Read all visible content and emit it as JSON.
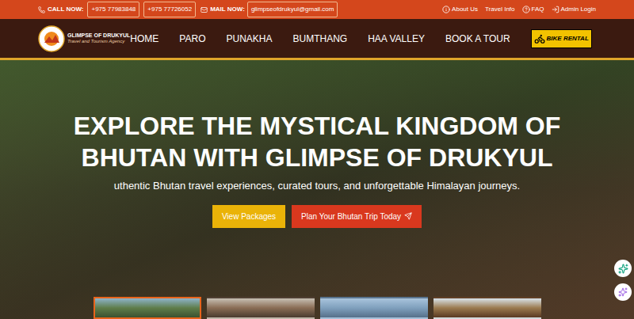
{
  "topbar": {
    "call_label": "CALL NOW:",
    "phones": [
      "+975 77983848",
      "+975 77726052"
    ],
    "mail_label": "MAIL NOW:",
    "email": "glimpseofdrukyul@gmail.com",
    "links": [
      {
        "label": "About Us",
        "kind": "info"
      },
      {
        "label": "Travel Info",
        "kind": "plain"
      },
      {
        "label": "FAQ",
        "kind": "help"
      },
      {
        "label": "Admin Login",
        "kind": "login"
      }
    ]
  },
  "logo": {
    "name": "GLIMPSE OF DRUKYUL",
    "tagline": "Travel and Tourism Agency"
  },
  "nav": {
    "items": [
      "HOME",
      "PARO",
      "PUNAKHA",
      "BUMTHANG",
      "HAA VALLEY",
      "BOOK A TOUR"
    ],
    "badge": "BIKE RENTAL"
  },
  "hero": {
    "title": "EXPLORE THE MYSTICAL KINGDOM OF BHUTAN WITH GLIMPSE OF DRUKYUL",
    "subtitle": "uthentic Bhutan travel experiences, curated tours, and unforgettable Himalayan journeys.",
    "buttons": [
      {
        "label": "View Packages",
        "kind": "primary"
      },
      {
        "label": "Plan Your Bhutan Trip Today",
        "kind": "secondary"
      }
    ]
  },
  "thumbnails": [
    {
      "selected": true
    },
    {
      "selected": false
    },
    {
      "selected": false
    },
    {
      "selected": false
    }
  ]
}
